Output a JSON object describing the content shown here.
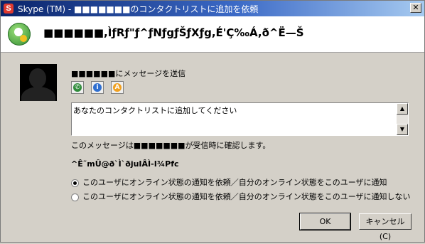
{
  "window": {
    "title": "Skype (TM) - ■■■■■■■のコンタクトリストに追加を依頼",
    "close_label": "✕"
  },
  "header": {
    "title": "■■■■■■,ÌƒRƒ\"ƒ^ƒNƒgƒŠƒXƒg,É'Ç‰Á,ð^Ë—Š"
  },
  "main": {
    "send_label": "■■■■■■にメッセージを送信",
    "message_text": "あなたのコンタクトリストに追加してください",
    "note": "このメッセージは■■■■■■■が受信時に確認します。",
    "section_heading": "^Ê˜mÛ@ð`Ì`ðjuIÂÌ-I¾Pfc",
    "options": [
      "このユーザにオンライン状態の通知を依頼／自分のオンライン状態をこのユーザに通知",
      "このユーザにオンライン状態の通知を依頼／自分のオンライン状態をこのユーザに通知しない"
    ],
    "selected_option": 0
  },
  "icons": {
    "app": "skype-icon",
    "header": "add-contact-icon",
    "call": "call-icon",
    "info": "info-icon",
    "sms": "sms-icon"
  },
  "colors": {
    "call_icon": "#2e8b3a",
    "info_icon": "#2f6fd0",
    "sms_icon": "#f0a020",
    "title_bar": "#0a246a"
  },
  "buttons": {
    "ok": "OK",
    "cancel": "キャンセル (C)"
  }
}
